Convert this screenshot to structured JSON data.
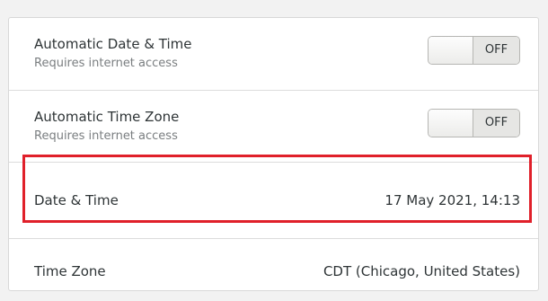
{
  "settings": {
    "automatic_date_time": {
      "title": "Automatic Date & Time",
      "subtitle": "Requires internet access",
      "toggle_state": "OFF"
    },
    "automatic_time_zone": {
      "title": "Automatic Time Zone",
      "subtitle": "Requires internet access",
      "toggle_state": "OFF"
    },
    "date_time": {
      "title": "Date & Time",
      "value": "17 May 2021, 14:13"
    },
    "time_zone": {
      "title": "Time Zone",
      "value": "CDT (Chicago, United States)"
    }
  },
  "colors": {
    "highlight": "#e0202a",
    "panel_background": "#ffffff",
    "page_background": "#f2f2f2"
  }
}
